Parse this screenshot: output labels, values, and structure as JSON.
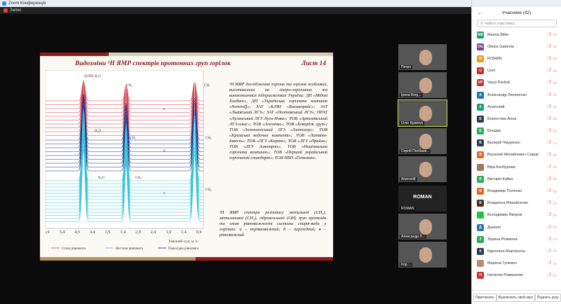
{
  "window": {
    "title": "Zoom Конференція",
    "recording": "Запис"
  },
  "slide": {
    "title": "Видозміни ¹H ЯМР спектрів протонних груп горілок",
    "sheet": "Лист 14",
    "paragraph1": "¹H ЯМР дослідження горілок та горілок особливих, виготовлених на лікеро-горілчаних та виноконьячних підприємствах України: ДП «Мідом Холдинг», ДП «Українська горілчана компанія «Nemiroff»; ЗАТ «КЛВЗ «Бахмачрайс»; ЗАТ «Львівський ЛГЗ»; ЗАТ «Полтавський ЛГЗ»; ПРАТ «Луганський ЛГЗ Луга-Нова»; ТОВ «Артемівський ЛГЗ-плюс»; ТОВ «Алгоніка»; ТОВ «Бевердж груп»; ТОВ «Золотоніський ЛГЗ «Златогор»; ТОВ «Кримська водочна компанія»; ТОВ «Латвіно-Інвест»; ТОВ «ЛГЗ «Карат»; ТОВ «ЛГЗ «Прайм»; ТОВ «ЛГЗ Алкотрон»; ТОВ «Національна горілчана компанія»; ТОВ «Перший український горілчаний стандарт»; ТОВ НВП «Гетьман».",
    "paragraph2": "¹H ЯМР спектри резонансу метильної (CH₃), метиленової (CH₂), гідроксильної (OH) груп протонів та стан рівноважності системи спирт-вода у горілках: а – нерівноважний; б – перехідний; в – рівноважний",
    "chart": {
      "x_ticks": [
        "5,9",
        "5,4",
        "4,9",
        "4,4",
        "3,9",
        "3,4",
        "2,9",
        "2,4",
        "1,9",
        "1,4",
        "0,9"
      ],
      "xlabel": "Хімічний зсув, м. ч.",
      "peak_labels": [
        "Σ(OH) H₂O",
        "CH₂",
        "CH₃",
        "H₂O",
        "CH₂",
        "CH₃",
        "H₂O",
        "CH₂",
        "CH₃"
      ],
      "group_labels": [
        "в",
        "б",
        "а"
      ],
      "peaks_ppm": [
        4.7,
        3.3,
        1.05
      ],
      "legend": [
        "Стала рівновага",
        "Нестала рівновага",
        "Перехідна рівновага"
      ],
      "colors": {
        "stable": "#d23a4a",
        "unstable": "#39c3d6",
        "transitional": "#1f2e8a"
      }
    }
  },
  "videos": [
    {
      "name": "Петро"
    },
    {
      "name": "Ірина Богд..."
    },
    {
      "name": "Олег Кравчук"
    },
    {
      "name": "Сергій Пелбаєв..."
    },
    {
      "name": "Анатолій"
    },
    {
      "name": "ROMAN",
      "label": "ROMAN"
    },
    {
      "name": "Александр Л..."
    },
    {
      "name": "Ігор ..."
    }
  ],
  "panel": {
    "title": "Учасники (42)",
    "search_placeholder": "Найти участника",
    "participants": [
      {
        "initials": "MB",
        "name": "Marina Bilko",
        "color": "#1f9d74",
        "cam": "on"
      },
      {
        "initials": "OG",
        "name": "Olesia Gabenia",
        "color": "#7b3fa0",
        "cam": "on"
      },
      {
        "initials": "R",
        "name": "ROMAN",
        "color": "#ee9b1e",
        "cam": "off"
      },
      {
        "initials": "U",
        "name": "User",
        "color": "#c7312f",
        "cam": "off"
      },
      {
        "initials": "VP",
        "name": "Vasyl Pavliuk",
        "color": "#c7312f",
        "cam": "off"
      },
      {
        "initials": "A",
        "name": "Александр Лисиченко",
        "color": "#2477a8",
        "cam": "on"
      },
      {
        "initials": "A",
        "name": "Анатолий",
        "color": "#1f9d74",
        "cam": "on"
      },
      {
        "initials": "Б",
        "name": "Берестова Анна",
        "color": "#2d3a4a",
        "cam": "off"
      },
      {
        "initials": "Б",
        "name": "Бондар",
        "color": "#2dab5a",
        "cam": "off"
      },
      {
        "initials": "В",
        "name": "Валерій Чмуренко",
        "color": "#2d3a4a",
        "cam": "on"
      },
      {
        "initials": "В",
        "name": "Василий Михайлович Сидор",
        "color": "#e06a1e",
        "cam": "off"
      },
      {
        "initials": "",
        "name": "Віра Калбурова",
        "color": "#9a7a66",
        "cam": "off"
      },
      {
        "initials": "В",
        "name": "Вікторія Кайко",
        "color": "#2dab5a",
        "cam": "off"
      },
      {
        "initials": "В",
        "name": "Владимир Полянко",
        "color": "#e06a1e",
        "cam": "off"
      },
      {
        "initials": "В",
        "name": "Владлена Михайленко",
        "color": "#4a2e26",
        "cam": "off"
      },
      {
        "initials": "",
        "name": "Володимир Яворов",
        "color": "#27c244",
        "cam": "off"
      },
      {
        "initials": "Д",
        "name": "Данило",
        "color": "#2477a8",
        "cam": "off"
      },
      {
        "initials": "З",
        "name": "Зоряна Романюк",
        "color": "#2dab5a",
        "cam": "on"
      },
      {
        "initials": "К",
        "name": "Каролина Мартисень",
        "color": "#2d3a4a",
        "cam": "on"
      },
      {
        "initials": "",
        "name": "Марина Гулевич",
        "color": "#b88d78",
        "cam": "off"
      },
      {
        "initials": "Н",
        "name": "Наталия Романенко",
        "color": "#c7312f",
        "cam": "off"
      }
    ],
    "buttons": [
      "Пригласить",
      "Выключить свой звук",
      "Поднять руку"
    ]
  }
}
